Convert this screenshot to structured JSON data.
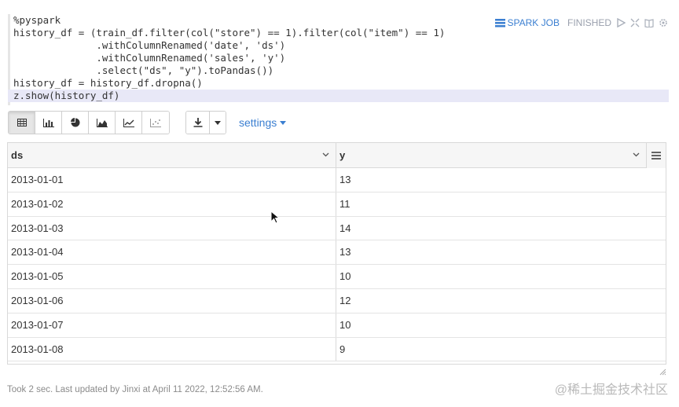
{
  "code": {
    "lines": [
      "%pyspark",
      "history_df = (train_df.filter(col(\"store\") == 1).filter(col(\"item\") == 1)",
      "              .withColumnRenamed('date', 'ds')",
      "              .withColumnRenamed('sales', 'y')",
      "              .select(\"ds\", \"y\").toPandas())",
      "history_df = history_df.dropna()",
      "z.show(history_df)"
    ]
  },
  "status": {
    "spark_job_label": "SPARK JOB",
    "state": "FINISHED",
    "icons": [
      "play-icon",
      "expand-icon",
      "book-icon",
      "gear-icon"
    ]
  },
  "toolbar": {
    "view_buttons": [
      "table-icon",
      "bar-chart-icon",
      "pie-chart-icon",
      "area-chart-icon",
      "line-chart-icon",
      "scatter-chart-icon"
    ],
    "active_view": "table-icon",
    "download_icon": "download-icon",
    "settings_label": "settings"
  },
  "table": {
    "columns": [
      "ds",
      "y"
    ],
    "rows": [
      [
        "2013-01-01",
        "13"
      ],
      [
        "2013-01-02",
        "11"
      ],
      [
        "2013-01-03",
        "14"
      ],
      [
        "2013-01-04",
        "13"
      ],
      [
        "2013-01-05",
        "10"
      ],
      [
        "2013-01-06",
        "12"
      ],
      [
        "2013-01-07",
        "10"
      ],
      [
        "2013-01-08",
        "9"
      ]
    ]
  },
  "footer": {
    "text": "Took 2 sec. Last updated by Jinxi at April 11 2022, 12:52:56 AM."
  },
  "watermark": "@稀土掘金技术社区",
  "colors": {
    "accent": "#3b7fd1",
    "highlight_line": "#e8e8f7",
    "header_bg": "#f6f6f6",
    "border": "#d9d9d9"
  }
}
